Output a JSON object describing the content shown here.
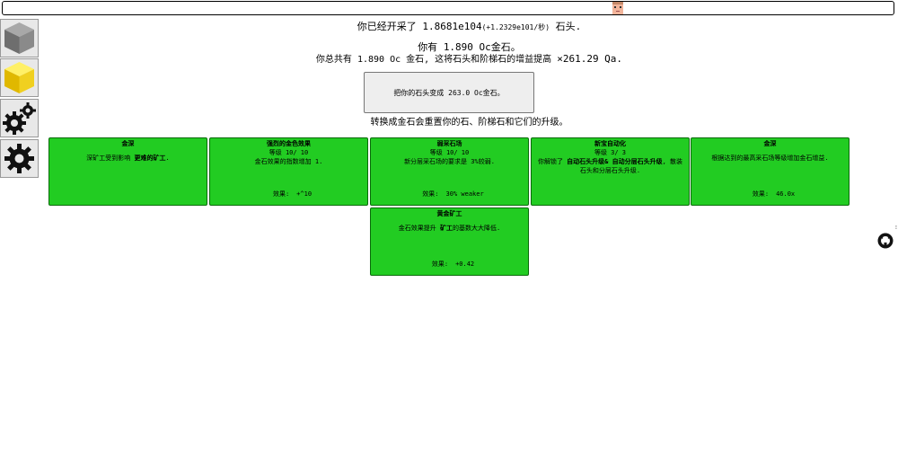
{
  "stats": {
    "mined_prefix": "你已经开采了",
    "mined_value": "1.8681e104",
    "mined_rate": "(+1.2329e101/秒)",
    "mined_suffix": "石头.",
    "have_prefix": "你有",
    "have_value": "1.890 Oc",
    "have_suffix": "金石。",
    "total_text": "你总共有 1.890 Oc 金石, 这将石头和阶梯石的增益提高",
    "total_mult": "×261.29 Qa."
  },
  "convert_button": "把你的石头变成 263.0 Oc金石。",
  "reset_note": "转换成金石会重置你的石、阶梯石和它们的升级。",
  "upgrades": [
    {
      "title": "金深",
      "level": "",
      "desc_html": "深矿工受到影响 <b>更难的矿工</b>.",
      "effect_label": "",
      "effect_value": ""
    },
    {
      "title": "强烈的金色效果",
      "level": "等级 10/ 10",
      "desc_html": "金石效果的指数增加 1.",
      "effect_label": "效果:",
      "effect_value": "+^10"
    },
    {
      "title": "弱采石场",
      "level": "等级 10/ 10",
      "desc_html": "新分层采石场的要求是 3%较弱.",
      "effect_label": "效果:",
      "effect_value": "30% weaker"
    },
    {
      "title": "新宝自动化",
      "level": "等级 3/ 3",
      "desc_html": "你解锁了 <b>自动石头升级&amp; 自动分层石头升级</b>, 散装石头和分层石头升级.",
      "effect_label": "",
      "effect_value": ""
    },
    {
      "title": "金深",
      "level": "",
      "desc_html": "根据达到的最高采石场等级增加金石增益.",
      "effect_label": "效果:",
      "effect_value": "46.0x"
    },
    {
      "title": "黄金矿工",
      "level": "",
      "desc_html": "金石效果提升 <b>矿工</b>的基数大大降低.",
      "effect_label": "效果:",
      "effect_value": "+0.42"
    }
  ],
  "side_dots": "⁝",
  "colors": {
    "card": "#22cc22",
    "card_border": "#0a6a0a",
    "stone": "#8a8a8a",
    "gold": "#f0d020"
  }
}
